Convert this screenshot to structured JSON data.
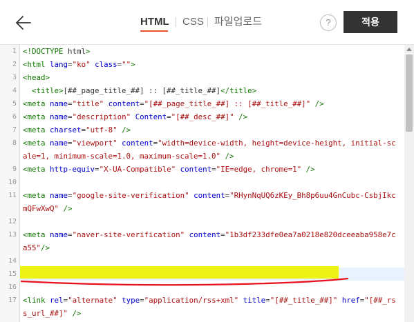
{
  "header": {
    "back_icon": "arrow-left-icon",
    "tabs": [
      {
        "label": "HTML",
        "active": true
      },
      {
        "label": "CSS",
        "active": false
      },
      {
        "label": "파일업로드",
        "active": false
      }
    ],
    "help_label": "?",
    "apply_label": "적용",
    "accent_color": "#e8502c"
  },
  "editor": {
    "lines": [
      {
        "num": "1",
        "text": "<!DOCTYPE html>"
      },
      {
        "num": "2",
        "text": "<html lang=\"ko\" class=\"\">"
      },
      {
        "num": "3",
        "text": "<head>"
      },
      {
        "num": "4",
        "text": "  <title>[##_page_title_##] :: [##_title_##]</title>"
      },
      {
        "num": "5",
        "text": "<meta name=\"title\" content=\"[##_page_title_##] :: [##_title_##]\" />"
      },
      {
        "num": "6",
        "text": "<meta name=\"description\" Content=\"[##_desc_##]\" />"
      },
      {
        "num": "7",
        "text": "<meta charset=\"utf-8\" />"
      },
      {
        "num": "8",
        "text": "<meta name=\"viewport\" content=\"width=device-width, height=device-height, initial-scale=1, minimum-scale=1.0, maximum-scale=1.0\" />"
      },
      {
        "num": "9",
        "text": "<meta http-equiv=\"X-UA-Compatible\" content=\"IE=edge, chrome=1\" />"
      },
      {
        "num": "10",
        "text": ""
      },
      {
        "num": "11",
        "text": "<meta name=\"google-site-verification\" content=\"RHynNqUQ6zKEy_Bh8p6uu4GnCubc-CsbjIkcmQFwXwQ\" />"
      },
      {
        "num": "12",
        "text": ""
      },
      {
        "num": "13",
        "text": "<meta name=\"naver-site-verification\" content=\"1b3df233dfe0ea7a0218e820dceeaba958e7ca55\"/>"
      },
      {
        "num": "14",
        "text": ""
      },
      {
        "num": "15",
        "text": ""
      },
      {
        "num": "16",
        "text": ""
      },
      {
        "num": "17",
        "text": "<link rel=\"alternate\" type=\"application/rss+xml\" title=\"[##_title_##]\" href=\"[##_rss_url_##]\" />"
      }
    ],
    "highlighted_line": "15",
    "redaction_color": "#eef20a",
    "underline_color": "#e8101a"
  }
}
